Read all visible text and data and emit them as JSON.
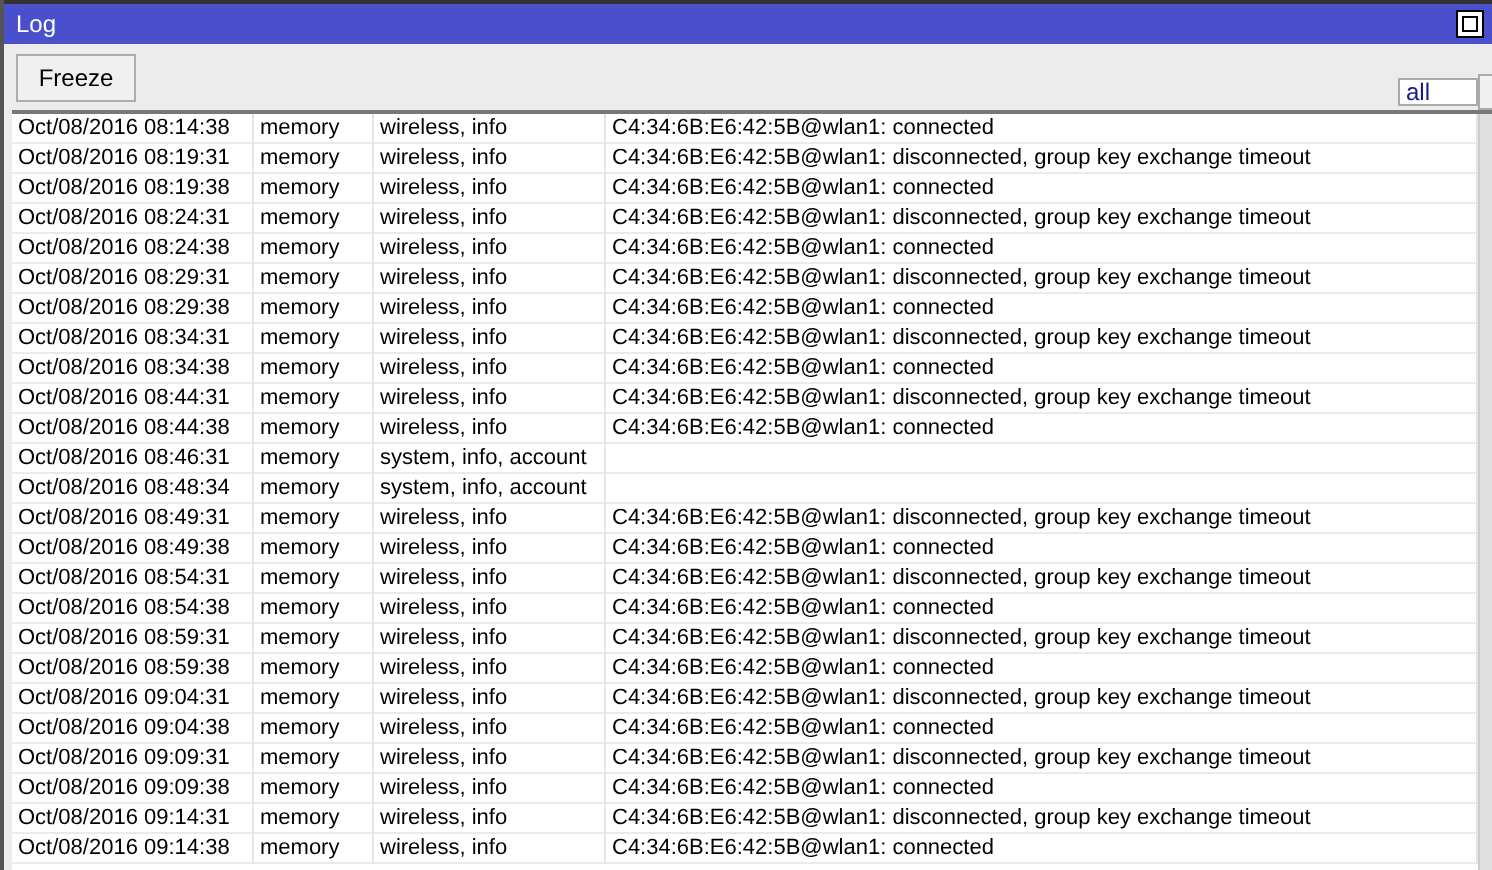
{
  "window": {
    "title": "Log"
  },
  "toolbar": {
    "freeze_button": "Freeze",
    "filter": {
      "value": "all"
    }
  },
  "table": {
    "rows": [
      {
        "time": "Oct/08/2016 08:14:38",
        "buffer": "memory",
        "topics": "wireless, info",
        "message": "C4:34:6B:E6:42:5B@wlan1: connected"
      },
      {
        "time": "Oct/08/2016 08:19:31",
        "buffer": "memory",
        "topics": "wireless, info",
        "message": "C4:34:6B:E6:42:5B@wlan1: disconnected, group key exchange timeout"
      },
      {
        "time": "Oct/08/2016 08:19:38",
        "buffer": "memory",
        "topics": "wireless, info",
        "message": "C4:34:6B:E6:42:5B@wlan1: connected"
      },
      {
        "time": "Oct/08/2016 08:24:31",
        "buffer": "memory",
        "topics": "wireless, info",
        "message": "C4:34:6B:E6:42:5B@wlan1: disconnected, group key exchange timeout"
      },
      {
        "time": "Oct/08/2016 08:24:38",
        "buffer": "memory",
        "topics": "wireless, info",
        "message": "C4:34:6B:E6:42:5B@wlan1: connected"
      },
      {
        "time": "Oct/08/2016 08:29:31",
        "buffer": "memory",
        "topics": "wireless, info",
        "message": "C4:34:6B:E6:42:5B@wlan1: disconnected, group key exchange timeout"
      },
      {
        "time": "Oct/08/2016 08:29:38",
        "buffer": "memory",
        "topics": "wireless, info",
        "message": "C4:34:6B:E6:42:5B@wlan1: connected"
      },
      {
        "time": "Oct/08/2016 08:34:31",
        "buffer": "memory",
        "topics": "wireless, info",
        "message": "C4:34:6B:E6:42:5B@wlan1: disconnected, group key exchange timeout"
      },
      {
        "time": "Oct/08/2016 08:34:38",
        "buffer": "memory",
        "topics": "wireless, info",
        "message": "C4:34:6B:E6:42:5B@wlan1: connected"
      },
      {
        "time": "Oct/08/2016 08:44:31",
        "buffer": "memory",
        "topics": "wireless, info",
        "message": "C4:34:6B:E6:42:5B@wlan1: disconnected, group key exchange timeout"
      },
      {
        "time": "Oct/08/2016 08:44:38",
        "buffer": "memory",
        "topics": "wireless, info",
        "message": "C4:34:6B:E6:42:5B@wlan1: connected"
      },
      {
        "time": "Oct/08/2016 08:46:31",
        "buffer": "memory",
        "topics": "system, info, account"
      },
      {
        "time": "Oct/08/2016 08:48:34",
        "buffer": "memory",
        "topics": "system, info, account"
      },
      {
        "time": "Oct/08/2016 08:49:31",
        "buffer": "memory",
        "topics": "wireless, info",
        "message": "C4:34:6B:E6:42:5B@wlan1: disconnected, group key exchange timeout"
      },
      {
        "time": "Oct/08/2016 08:49:38",
        "buffer": "memory",
        "topics": "wireless, info",
        "message": "C4:34:6B:E6:42:5B@wlan1: connected"
      },
      {
        "time": "Oct/08/2016 08:54:31",
        "buffer": "memory",
        "topics": "wireless, info",
        "message": "C4:34:6B:E6:42:5B@wlan1: disconnected, group key exchange timeout"
      },
      {
        "time": "Oct/08/2016 08:54:38",
        "buffer": "memory",
        "topics": "wireless, info",
        "message": "C4:34:6B:E6:42:5B@wlan1: connected"
      },
      {
        "time": "Oct/08/2016 08:59:31",
        "buffer": "memory",
        "topics": "wireless, info",
        "message": "C4:34:6B:E6:42:5B@wlan1: disconnected, group key exchange timeout"
      },
      {
        "time": "Oct/08/2016 08:59:38",
        "buffer": "memory",
        "topics": "wireless, info",
        "message": "C4:34:6B:E6:42:5B@wlan1: connected"
      },
      {
        "time": "Oct/08/2016 09:04:31",
        "buffer": "memory",
        "topics": "wireless, info",
        "message": "C4:34:6B:E6:42:5B@wlan1: disconnected, group key exchange timeout"
      },
      {
        "time": "Oct/08/2016 09:04:38",
        "buffer": "memory",
        "topics": "wireless, info",
        "message": "C4:34:6B:E6:42:5B@wlan1: connected"
      },
      {
        "time": "Oct/08/2016 09:09:31",
        "buffer": "memory",
        "topics": "wireless, info",
        "message": "C4:34:6B:E6:42:5B@wlan1: disconnected, group key exchange timeout"
      },
      {
        "time": "Oct/08/2016 09:09:38",
        "buffer": "memory",
        "topics": "wireless, info",
        "message": "C4:34:6B:E6:42:5B@wlan1: connected"
      },
      {
        "time": "Oct/08/2016 09:14:31",
        "buffer": "memory",
        "topics": "wireless, info",
        "message": "C4:34:6B:E6:42:5B@wlan1: disconnected, group key exchange timeout"
      },
      {
        "time": "Oct/08/2016 09:14:38",
        "buffer": "memory",
        "topics": "wireless, info",
        "message": "C4:34:6B:E6:42:5B@wlan1: connected"
      }
    ]
  }
}
